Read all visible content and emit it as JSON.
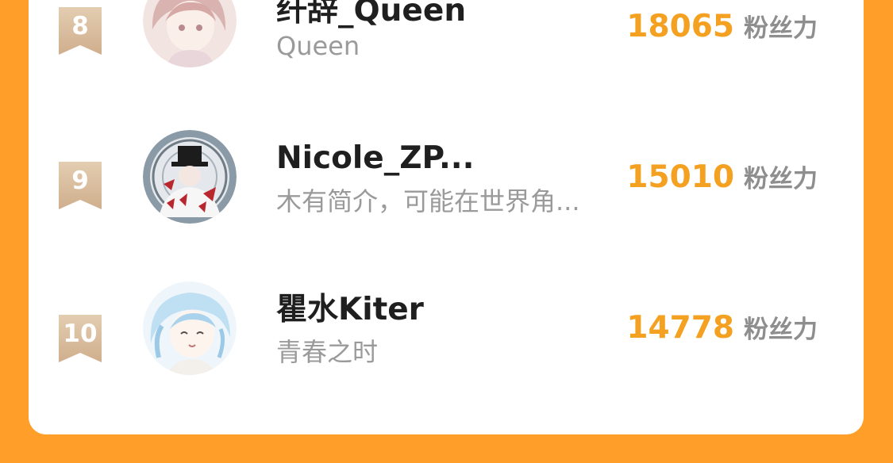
{
  "leaderboard": {
    "rows": [
      {
        "rank": "8",
        "name": "纤辞_Queen",
        "bio": "Queen",
        "score": "18065",
        "score_unit": "粉丝力"
      },
      {
        "rank": "9",
        "name": "Nicole_ZP...",
        "bio": "木有简介，可能在世界角...",
        "score": "15010",
        "score_unit": "粉丝力"
      },
      {
        "rank": "10",
        "name": "瞿水Kiter",
        "bio": "青春之时",
        "score": "14778",
        "score_unit": "粉丝力"
      }
    ]
  },
  "colors": {
    "background": "#FF9F2A",
    "card": "#FFFFFF",
    "score": "#F4A021",
    "rank_badge": "#D9BE9E"
  }
}
